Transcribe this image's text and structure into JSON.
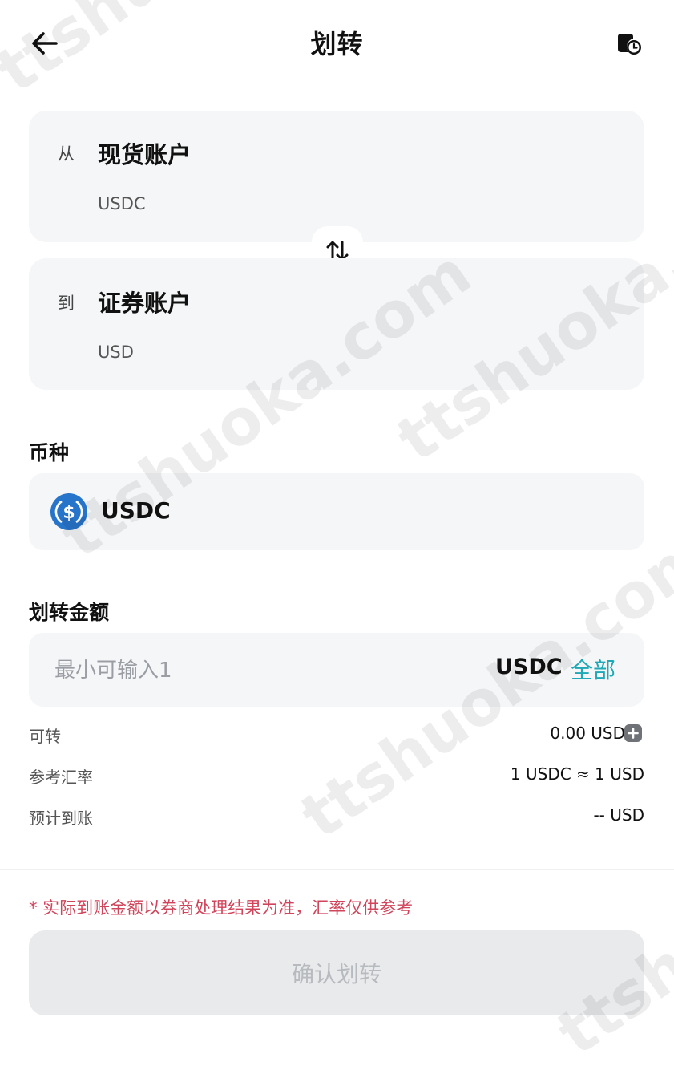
{
  "header": {
    "title": "划转",
    "back_icon": "arrow-left-icon",
    "history_icon": "history-clock-icon"
  },
  "transfer": {
    "from": {
      "direction_label": "从",
      "account_name": "现货账户",
      "currency": "USDC"
    },
    "to": {
      "direction_label": "到",
      "account_name": "证券账户",
      "currency": "USD"
    },
    "swap_icon": "swap-vertical-icon"
  },
  "coin": {
    "section_label": "币种",
    "selected": "USDC",
    "icon": "usdc-coin-icon"
  },
  "amount": {
    "section_label": "划转金额",
    "placeholder": "最小可输入1",
    "value": "",
    "unit": "USDC",
    "all_label": "全部"
  },
  "info": {
    "available_label": "可转",
    "available_value": "0.00 USDC",
    "rate_label": "参考汇率",
    "rate_value": "1 USDC ≈ 1 USD",
    "estimated_label": "预计到账",
    "estimated_value": "-- USD",
    "add_icon": "plus-icon"
  },
  "notice": "* 实际到账金额以券商处理结果为准，汇率仅供参考",
  "confirm_label": "确认划转",
  "watermark": "ttshuoka.com",
  "colors": {
    "accent": "#1fa9b6",
    "notice": "#d0455b",
    "usdc_blue": "#2775ca",
    "card_bg": "#f5f6f7"
  }
}
